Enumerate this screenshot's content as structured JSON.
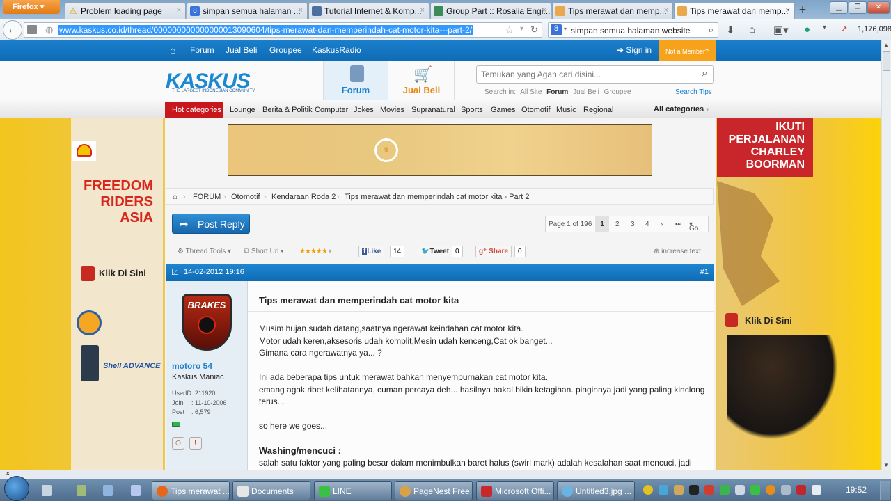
{
  "browser": {
    "menu_label": "Firefox",
    "tabs": [
      {
        "title": "Problem loading page",
        "icon": "warning-icon"
      },
      {
        "title": "simpan semua halaman ...",
        "icon": "google-icon"
      },
      {
        "title": "Tutorial Internet & Komp...",
        "icon": "page-icon"
      },
      {
        "title": "Group Part :: Rosalia Engi...",
        "icon": "page-icon"
      },
      {
        "title": "Tips merawat dan memp...",
        "icon": "kaskus-icon"
      },
      {
        "title": "Tips merawat dan memp...",
        "icon": "kaskus-icon",
        "active": true
      }
    ],
    "url": "www.kaskus.co.id/thread/000000000000000013090604/tips-merawat-dan-memperindah-cat-motor-kita---part-2/",
    "search_value": "simpan semua halaman website",
    "counter": "1,176,098"
  },
  "site": {
    "topnav": [
      "Forum",
      "Jual Beli",
      "Groupee",
      "KaskusRadio"
    ],
    "sign_in": "Sign in",
    "not_member": "Not a Member?",
    "logo": "KASKUS",
    "logo_tagline": "THE LARGEST INDONESIAN COMMUNITY",
    "header_tabs": [
      "Forum",
      "Jual Beli"
    ],
    "search_placeholder": "Temukan yang Agan cari disini...",
    "search_in_label": "Search in:",
    "search_in_options": [
      "All Site",
      "Forum",
      "Jual Beli",
      "Groupee"
    ],
    "search_in_selected": "Forum",
    "search_tips": "Search Tips",
    "hot_categories": "Hot categories",
    "categories": [
      "Lounge",
      "Berita & Politik",
      "Computer",
      "Jokes",
      "Movies",
      "Supranatural",
      "Sports",
      "Games",
      "Otomotif",
      "Music",
      "Regional"
    ],
    "all_categories": "All categories"
  },
  "ads": {
    "left_title": [
      "FREEDOM",
      "RIDERS",
      "ASIA"
    ],
    "left_cta": "Klik Di Sini",
    "left_brand": "Shell ADVANCE",
    "right_title": [
      "IKUTI",
      "PERJALANAN",
      "CHARLEY",
      "BOORMAN"
    ],
    "right_cta": "Klik Di Sini"
  },
  "thread": {
    "breadcrumb": [
      "FORUM",
      "Otomotif",
      "Kendaraan Roda 2",
      "Tips merawat dan memperindah cat motor kita - Part 2"
    ],
    "post_reply": "Post Reply",
    "pager": {
      "label": "Page 1 of 196",
      "pages": [
        "1",
        "2",
        "3",
        "4"
      ],
      "current": "1",
      "go": "Go"
    },
    "tools": {
      "thread_tools": "Thread Tools",
      "short_url": "Short Url",
      "rating_stars": 5,
      "like": "Like",
      "like_count": "14",
      "tweet": "Tweet",
      "tweet_count": "0",
      "share": "Share",
      "share_count": "0",
      "increase_text": "increase text"
    }
  },
  "post": {
    "date": "14-02-2012 19:16",
    "number": "#1",
    "user": {
      "name": "motoro 54",
      "title": "Kaskus Maniac",
      "userid_label": "UserID",
      "userid": ": 211920",
      "join_label": "Join",
      "join": ": 11-10-2006",
      "post_label": "Post",
      "posts": ": 6,579",
      "avatar_text": "BRAKES"
    },
    "title": "Tips merawat dan memperindah cat motor kita",
    "paragraphs": [
      "Musim hujan sudah datang,saatnya ngerawat keindahan cat motor kita.\nMotor udah keren,aksesoris udah komplit,Mesin udah kenceng,Cat ok banget...\nGimana cara ngerawatnya ya... ?",
      "Ini ada beberapa tips untuk merawat bahkan menyempurnakan cat motor kita.\nemang agak ribet kelihatannya, cuman percaya deh... hasilnya bakal bikin ketagihan. pinginnya jadi yang paling kinclong terus...",
      "so here we goes..."
    ],
    "section_heading": "Washing/mencuci :",
    "section_text": "salah satu faktor yang paling besar dalam menimbulkan baret halus (swirl mark) adalah kesalahan saat mencuci, jadi"
  },
  "taskbar": {
    "tasks": [
      "Tips merawat ...",
      "Documents",
      "LINE",
      "PageNest Free...",
      "Microsoft Offi...",
      "Untitled3.jpg ..."
    ],
    "clock": "19:52"
  },
  "colors": {
    "kaskus_blue": "#1b7fcc",
    "hot_red": "#c8171d",
    "not_member_orange": "#f7a21b"
  }
}
